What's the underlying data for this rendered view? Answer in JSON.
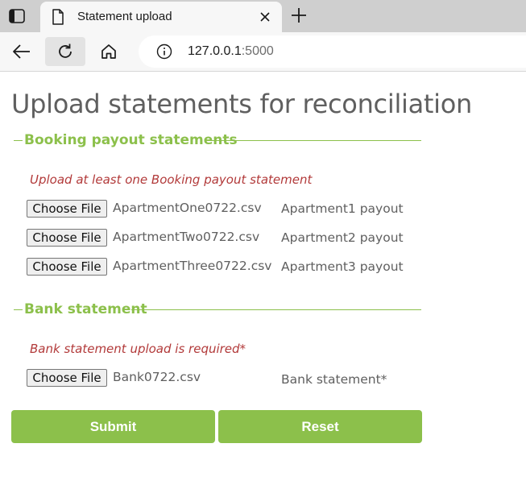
{
  "browser": {
    "tab_title": "Statement upload",
    "url_host": "127.0.0.1",
    "url_port": ":5000"
  },
  "page": {
    "title": "Upload statements for reconciliation",
    "accent_color": "#8cc04b",
    "error_color": "#b23a3a",
    "booking": {
      "legend": "Booking payout statements",
      "hint": "Upload at least one Booking payout statement",
      "files": [
        {
          "button": "Choose File",
          "file_name": "ApartmentOne0722.csv",
          "label": "Apartment1 payout"
        },
        {
          "button": "Choose File",
          "file_name": "ApartmentTwo0722.csv",
          "label": "Apartment2 payout"
        },
        {
          "button": "Choose File",
          "file_name": "ApartmentThree0722.csv",
          "label": "Apartment3 payout"
        }
      ]
    },
    "bank": {
      "legend": "Bank statement",
      "hint": "Bank statement upload is required*",
      "file": {
        "button": "Choose File",
        "file_name": "Bank0722.csv",
        "label": "Bank statement*"
      }
    },
    "actions": {
      "submit": "Submit",
      "reset": "Reset"
    }
  }
}
